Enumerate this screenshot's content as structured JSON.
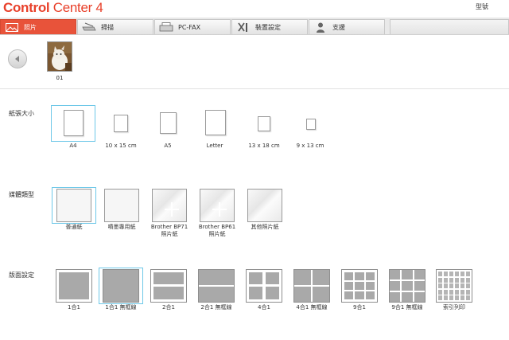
{
  "app": {
    "logo_part1": "Control",
    "logo_part2": " Center 4",
    "model_label": "型號"
  },
  "tabs": [
    {
      "label": "照片",
      "icon": "photo-icon",
      "active": true
    },
    {
      "label": "掃描",
      "icon": "scanner-icon",
      "active": false
    },
    {
      "label": "PC-FAX",
      "icon": "fax-icon",
      "active": false
    },
    {
      "label": "裝置設定",
      "icon": "tools-icon",
      "active": false
    },
    {
      "label": "支援",
      "icon": "person-icon",
      "active": false
    }
  ],
  "photos": [
    {
      "label": "01"
    }
  ],
  "paper_size": {
    "label": "紙張大小",
    "options": [
      {
        "label": "A4",
        "selected": true
      },
      {
        "label": "10 x 15 cm",
        "selected": false
      },
      {
        "label": "A5",
        "selected": false
      },
      {
        "label": "Letter",
        "selected": false
      },
      {
        "label": "13 x 18 cm",
        "selected": false
      },
      {
        "label": "9 x 13 cm",
        "selected": false
      }
    ]
  },
  "media_type": {
    "label": "媒體類型",
    "options": [
      {
        "label": "普通紙",
        "selected": true
      },
      {
        "label": "噴墨專用紙",
        "selected": false
      },
      {
        "label": "Brother BP71\n照片紙",
        "selected": false
      },
      {
        "label": "Brother BP61\n照片紙",
        "selected": false
      },
      {
        "label": "其他照片紙",
        "selected": false
      }
    ]
  },
  "layout": {
    "label": "版面設定",
    "options": [
      {
        "label": "1合1",
        "selected": false
      },
      {
        "label": "1合1 無框線",
        "selected": true
      },
      {
        "label": "2合1",
        "selected": false
      },
      {
        "label": "2合1 無框線",
        "selected": false
      },
      {
        "label": "4合1",
        "selected": false
      },
      {
        "label": "4合1 無框線",
        "selected": false
      },
      {
        "label": "9合1",
        "selected": false
      },
      {
        "label": "9合1 無框線",
        "selected": false
      },
      {
        "label": "索引列印",
        "selected": false
      }
    ]
  },
  "colors": {
    "accent": "#e8533a",
    "selection": "#6ec8e8"
  }
}
